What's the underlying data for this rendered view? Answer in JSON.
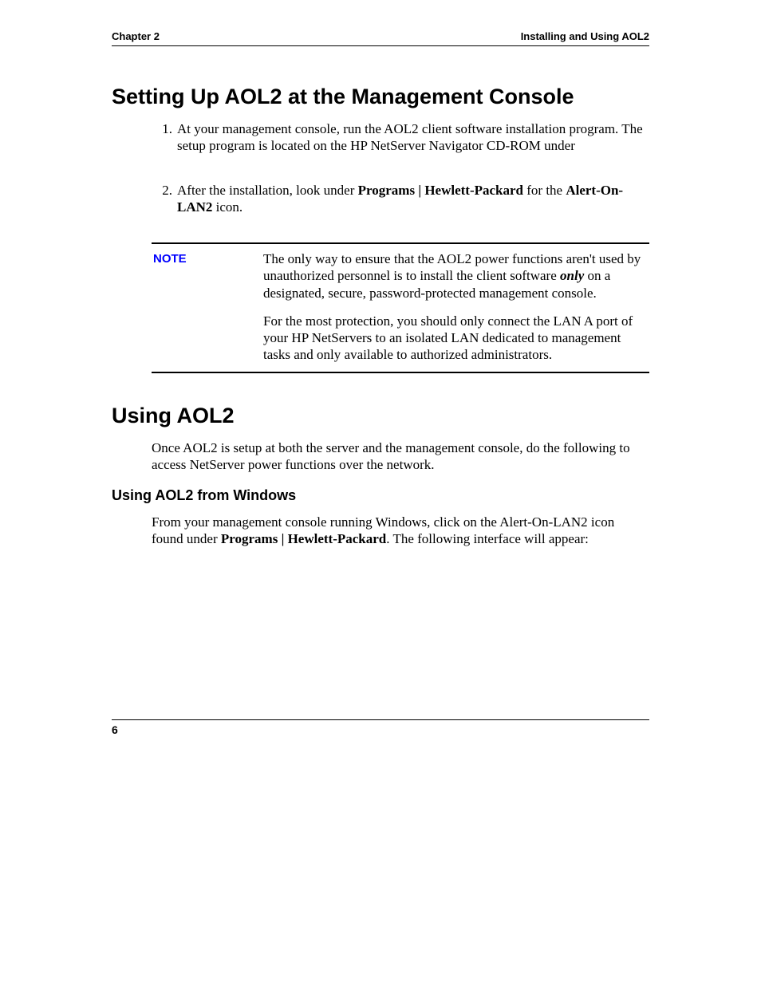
{
  "header": {
    "left": "Chapter 2",
    "right": "Installing and Using AOL2"
  },
  "section1": {
    "title": "Setting Up AOL2 at the Management Console",
    "items": {
      "n1": "1.",
      "t1": "At your management console, run the AOL2 client software installation program. The setup program is located on the HP NetServer Navigator CD-ROM under",
      "n2": "2.",
      "t2a": "After the installation, look under ",
      "t2b": "Programs | Hewlett-Packard",
      "t2c": " for the ",
      "t2d": "Alert-On-LAN2",
      "t2e": " icon."
    }
  },
  "note": {
    "label": "NOTE",
    "p1a": "The only way to ensure that the AOL2 power functions aren't used by unauthorized personnel is to install the client software ",
    "p1b": "only",
    "p1c": " on a designated, secure, password-protected management console.",
    "p2": "For the most protection, you should only connect the LAN A port of your HP NetServers to an isolated LAN dedicated to management tasks and only available to authorized administrators."
  },
  "section2": {
    "title": "Using AOL2",
    "intro": "Once AOL2 is setup at both the server and the management console, do the following to access NetServer power functions over the network.",
    "sub": "Using AOL2 from Windows",
    "body_a": "From your management console running Windows, click on the Alert-On-LAN2 icon found under ",
    "body_b": "Programs | Hewlett-Packard",
    "body_c": ". The following interface will appear:"
  },
  "footer": {
    "page": "6"
  }
}
